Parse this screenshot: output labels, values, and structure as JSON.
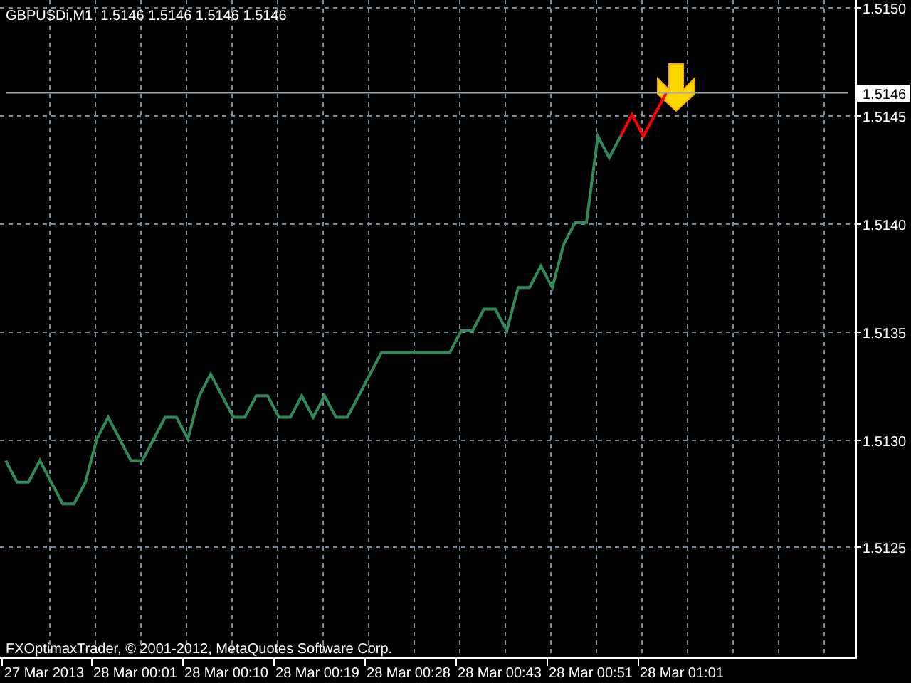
{
  "chart": {
    "title": "GBPUSDi,M1  1.5146 1.5146 1.5146 1.5146",
    "copyright": "FXOptimaxTrader, © 2001-2012, MetaQuotes Software Corp.",
    "chart_data": {
      "type": "line",
      "categories": [
        null,
        null,
        null,
        "27 Mar 2013",
        null,
        null,
        null,
        null,
        null,
        null,
        null,
        "28 Mar 00:01",
        null,
        null,
        null,
        null,
        null,
        null,
        null,
        "28 Mar 00:10",
        null,
        null,
        null,
        null,
        null,
        null,
        null,
        "28 Mar 00:19",
        null,
        null,
        null,
        null,
        null,
        null,
        null,
        "28 Mar 00:28",
        null,
        null,
        null,
        null,
        null,
        null,
        null,
        "28 Mar 00:43",
        null,
        null,
        null,
        null,
        null,
        null,
        null,
        "28 Mar 00:51",
        null,
        null,
        null,
        null,
        null,
        null,
        null,
        "28 Mar 01:01",
        null,
        null,
        null,
        null,
        null,
        null,
        null,
        null,
        null,
        null,
        null,
        null,
        null,
        null,
        null
      ],
      "series": [
        {
          "color": "#2e8b57",
          "values": [
            1.5129,
            1.5128,
            1.5128,
            1.5129,
            1.5128,
            1.5127,
            1.5127,
            1.5128,
            1.513,
            1.5131,
            1.513,
            1.5129,
            1.5129,
            1.513,
            1.5131,
            1.5131,
            1.513,
            1.5132,
            1.5133,
            1.5132,
            1.5131,
            1.5131,
            1.5132,
            1.5132,
            1.5131,
            1.5131,
            1.5132,
            1.5131,
            1.5132,
            1.5131,
            1.5131,
            1.5132,
            1.5133,
            1.5134,
            1.5134,
            1.5134,
            1.5134,
            1.5134,
            1.5134,
            1.5134,
            1.5135,
            1.5135,
            1.5136,
            1.5136,
            1.5135,
            1.5137,
            1.5137,
            1.5138,
            1.5137,
            1.5139,
            1.514,
            1.514,
            1.5144,
            1.5143,
            1.5144,
            null,
            null,
            null,
            null,
            null,
            null,
            null,
            null,
            null,
            null,
            null,
            null,
            null,
            null,
            null,
            null,
            null,
            null,
            null,
            null
          ]
        },
        {
          "color": "#ff0000",
          "values": [
            null,
            null,
            null,
            null,
            null,
            null,
            null,
            null,
            null,
            null,
            null,
            null,
            null,
            null,
            null,
            null,
            null,
            null,
            null,
            null,
            null,
            null,
            null,
            null,
            null,
            null,
            null,
            null,
            null,
            null,
            null,
            null,
            null,
            null,
            null,
            null,
            null,
            null,
            null,
            null,
            null,
            null,
            null,
            null,
            null,
            null,
            null,
            null,
            null,
            null,
            null,
            null,
            null,
            null,
            1.5144,
            1.5145,
            1.5144,
            1.5145,
            1.5146,
            null,
            null,
            null,
            null,
            null,
            null,
            null,
            null,
            null,
            null,
            null,
            null,
            null,
            null,
            null,
            null
          ]
        },
        {
          "name": "1.5146",
          "color": "#a0a8b0",
          "values": [
            1.5146,
            1.5146,
            1.5146,
            1.5146,
            1.5146,
            1.5146,
            1.5146,
            1.5146,
            1.5146,
            1.5146,
            1.5146,
            1.5146,
            1.5146,
            1.5146,
            1.5146,
            1.5146,
            1.5146,
            1.5146,
            1.5146,
            1.5146,
            1.5146,
            1.5146,
            1.5146,
            1.5146,
            1.5146,
            1.5146,
            1.5146,
            1.5146,
            1.5146,
            1.5146,
            1.5146,
            1.5146,
            1.5146,
            1.5146,
            1.5146,
            1.5146,
            1.5146,
            1.5146,
            1.5146,
            1.5146,
            1.5146,
            1.5146,
            1.5146,
            1.5146,
            1.5146,
            1.5146,
            1.5146,
            1.5146,
            1.5146,
            1.5146,
            1.5146,
            1.5146,
            1.5146,
            1.5146,
            1.5146,
            1.5146,
            1.5146,
            1.5146,
            1.5146,
            1.5146,
            1.5146,
            1.5146,
            1.5146,
            1.5146,
            1.5146,
            1.5146,
            1.5146,
            1.5146,
            1.5146,
            1.5146,
            1.5146,
            1.5146,
            1.5146,
            1.5146,
            1.5146
          ]
        }
      ],
      "grid": true,
      "ylim": [
        1.51199,
        1.51503
      ],
      "yticks": [
        {
          "value": 1.515,
          "label": "1.5150"
        },
        {
          "value": 1.5145,
          "label": "1.5145"
        },
        {
          "value": 1.514,
          "label": "1.5140"
        },
        {
          "value": 1.5135,
          "label": "1.5135"
        },
        {
          "value": 1.513,
          "label": "1.5130"
        },
        {
          "value": 1.5125,
          "label": "1.5125"
        }
      ]
    }
  }
}
